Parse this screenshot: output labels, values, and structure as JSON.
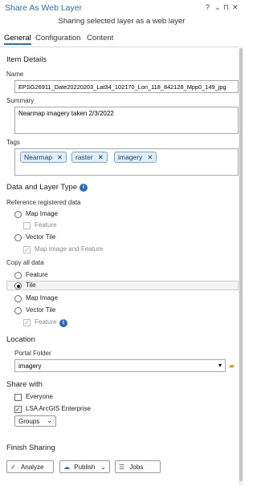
{
  "window": {
    "title": "Share As Web Layer",
    "subtitle": "Sharing selected layer as a web layer",
    "controls": {
      "help": "?",
      "menu": "⌄",
      "pin": "⊓",
      "close": "✕"
    }
  },
  "tabs": [
    {
      "label": "General",
      "active": true
    },
    {
      "label": "Configuration",
      "active": false
    },
    {
      "label": "Content",
      "active": false
    }
  ],
  "item_details": {
    "heading": "Item Details",
    "name_label": "Name",
    "name_value": "EPSG26911_Date20220203_Lat34_102170_Lon_118_842128_Mpp0_149_jpg",
    "summary_label": "Summary",
    "summary_value": "Nearmap imagery taken 2/3/2022",
    "tags_label": "Tags",
    "tags": [
      "Nearmap",
      "raster",
      "imagery"
    ],
    "tag_remove_glyph": "✕"
  },
  "data_layer": {
    "heading": "Data and Layer Type",
    "info_glyph": "i",
    "reference_label": "Reference registered data",
    "ref_map_image": "Map Image",
    "ref_feature": "Feature",
    "ref_vector_tile": "Vector Tile",
    "ref_map_image_feature": "Map Image and Feature",
    "copy_label": "Copy all data",
    "copy_feature": "Feature",
    "copy_tile": "Tile",
    "copy_map_image": "Map Image",
    "copy_vector_tile": "Vector Tile",
    "copy_feature_sub": "Feature",
    "check_glyph": "✓"
  },
  "location": {
    "heading": "Location",
    "portal_label": "Portal Folder",
    "portal_value": "imagery",
    "dropdown_glyph": "▾",
    "folder_icon_glyph": "▰"
  },
  "share_with": {
    "heading": "Share with",
    "everyone": "Everyone",
    "org": "LSA ArcGIS Enterprise",
    "groups": "Groups",
    "groups_glyph": "⌄"
  },
  "finish": {
    "heading": "Finish Sharing",
    "analyze": "Analyze",
    "analyze_glyph": "✓",
    "publish": "Publish",
    "publish_glyph": "☁",
    "publish_arrow": "⌄",
    "jobs": "Jobs",
    "jobs_glyph": "☰"
  },
  "colors": {
    "accent": "#2a6fb5",
    "tag_bg": "#dfeefb",
    "check_green": "#2e9a3a"
  }
}
